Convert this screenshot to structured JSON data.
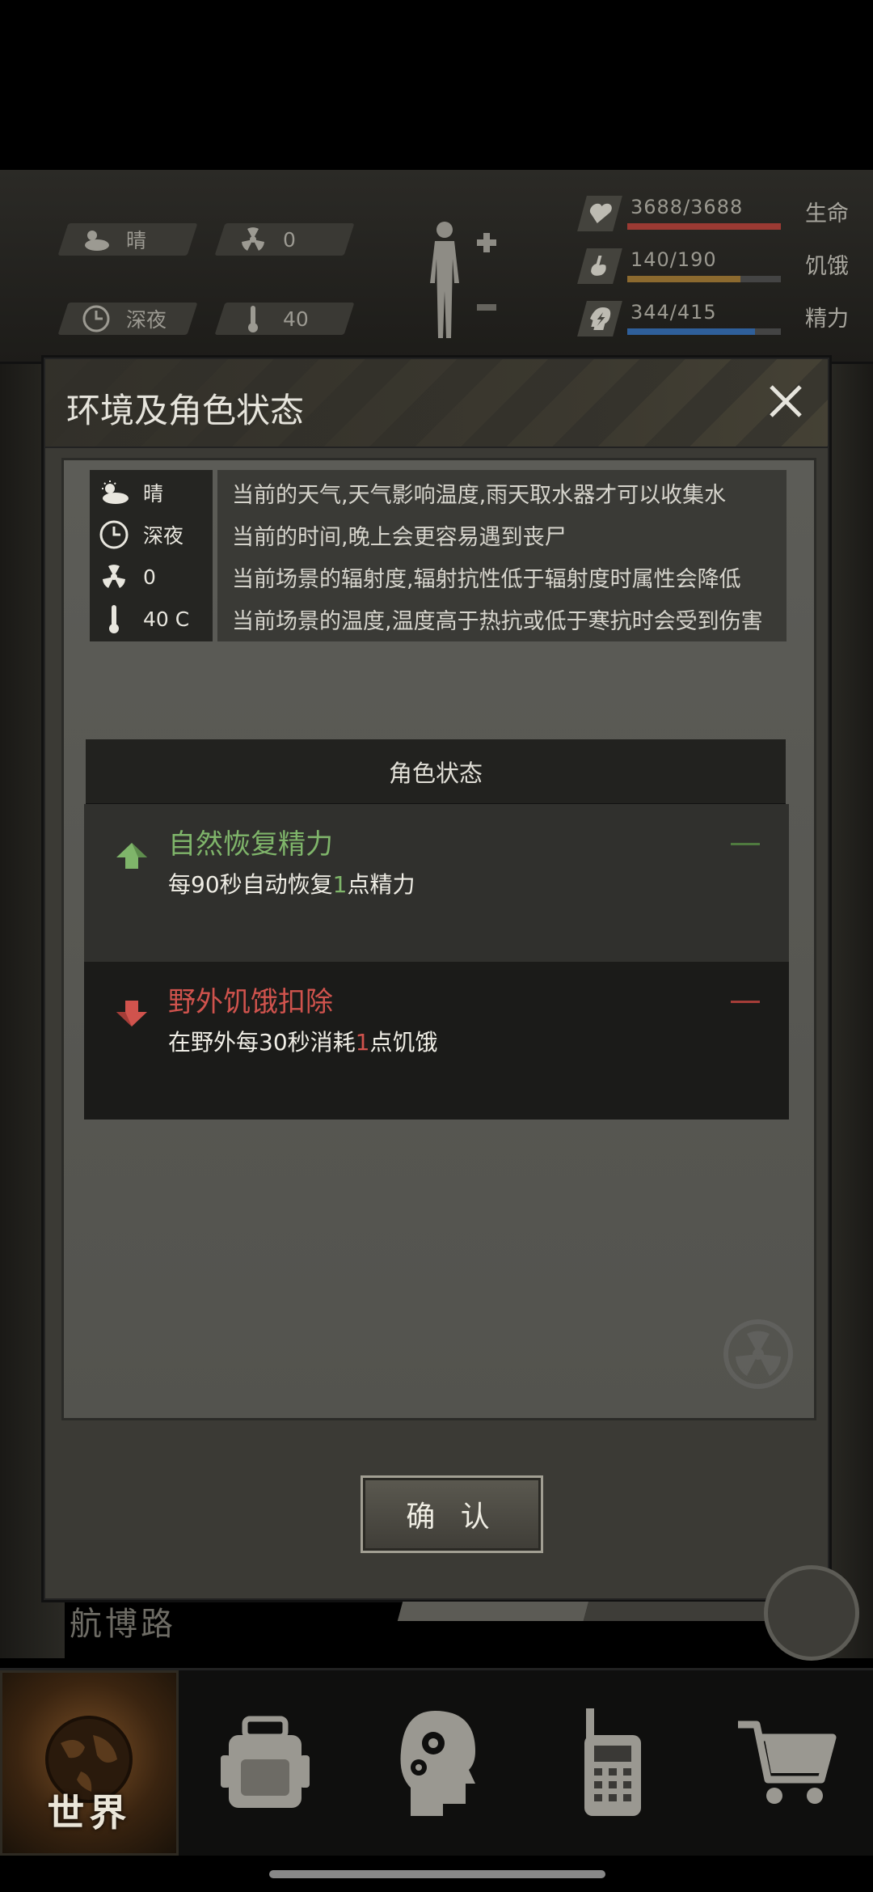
{
  "hud": {
    "weather": "晴",
    "radiation": "0",
    "time": "深夜",
    "temperature": "40",
    "stats": [
      {
        "name": "生命",
        "value": "3688/3688",
        "fraction": 1.0,
        "color": "#9b3a33"
      },
      {
        "name": "饥饿",
        "value": "140/190",
        "fraction": 0.737,
        "color": "#8c6a2f"
      },
      {
        "name": "精力",
        "value": "344/415",
        "fraction": 0.829,
        "color": "#2f5f9a"
      }
    ]
  },
  "modal": {
    "title": "环境及角色状态",
    "env_rows": [
      {
        "key": "晴",
        "icon": "weather-icon",
        "desc": "当前的天气,天气影响温度,雨天取水器才可以收集水"
      },
      {
        "key": "深夜",
        "icon": "clock-icon",
        "desc": "当前的时间,晚上会更容易遇到丧尸"
      },
      {
        "key": "0",
        "icon": "radiation-icon",
        "desc": "当前场景的辐射度,辐射抗性低于辐射度时属性会降低"
      },
      {
        "key": "40 C",
        "icon": "thermometer-icon",
        "desc": "当前场景的温度,温度高于热抗或低于寒抗时会受到伤害"
      }
    ],
    "role_header": "角色状态",
    "effects": [
      {
        "title": "自然恢复精力",
        "desc_pre": "每90秒自动恢复",
        "desc_num": "1",
        "desc_post": "点精力",
        "type": "buff",
        "title_color": "#7fb56a"
      },
      {
        "title": "野外饥饿扣除",
        "desc_pre": "在野外每30秒消耗",
        "desc_num": "1",
        "desc_post": "点饥饿",
        "type": "debuff",
        "title_color": "#d0534d"
      }
    ],
    "confirm_label": "确 认"
  },
  "location": "航博路",
  "nav": {
    "items": [
      {
        "label": "世界",
        "icon": "globe-icon",
        "active": true
      },
      {
        "label": "",
        "icon": "backpack-icon",
        "active": false
      },
      {
        "label": "",
        "icon": "head-gears-icon",
        "active": false
      },
      {
        "label": "",
        "icon": "radio-icon",
        "active": false
      },
      {
        "label": "",
        "icon": "cart-icon",
        "active": false
      }
    ]
  }
}
